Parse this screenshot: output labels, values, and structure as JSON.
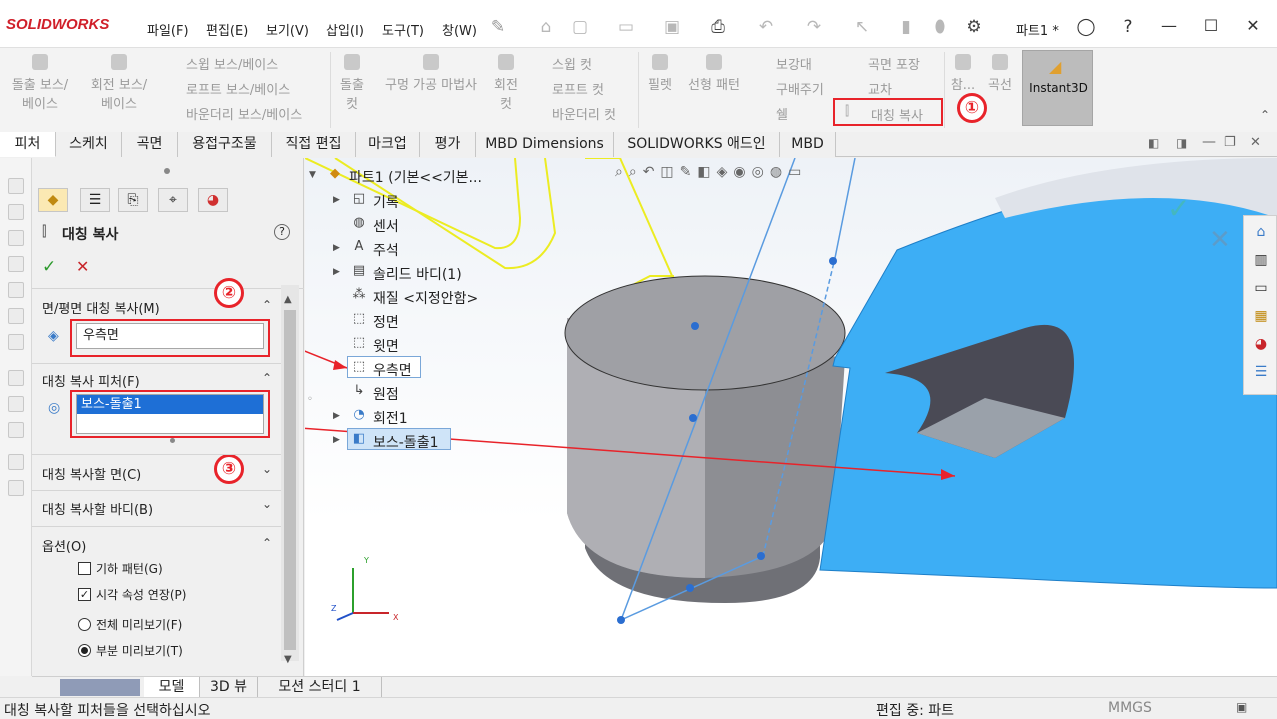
{
  "app": {
    "logo": "SOLIDWORKS",
    "doc_title": "파트1 *"
  },
  "menu": [
    "파일(F)",
    "편집(E)",
    "보기(V)",
    "삽입(I)",
    "도구(T)",
    "창(W)"
  ],
  "quick_access_icons": [
    "pin-icon",
    "home-icon",
    "new-icon",
    "open-icon",
    "save-icon",
    "print-icon",
    "undo-icon",
    "redo-icon",
    "select-icon",
    "traffic-light-icon",
    "options-icon"
  ],
  "title_icons": [
    "user-icon",
    "help-icon"
  ],
  "ribbon": {
    "col1": [
      "돌출 보스/\n베이스",
      "회전 보스/\n베이스"
    ],
    "col1_small": [
      "스윕 보스/베이스",
      "로프트 보스/베이스",
      "바운더리 보스/베이스"
    ],
    "col2": [
      "돌출\n컷",
      "구멍 가공 마법사",
      "회전\n컷"
    ],
    "col2_small": [
      "스윕 컷",
      "로프트 컷",
      "바운더리 컷"
    ],
    "col3": [
      "필렛",
      "선형 패턴"
    ],
    "col3_small": [
      "보강대",
      "구배주기",
      "쉘"
    ],
    "col3_small_b": [
      "곡면 포장",
      "교차",
      "대칭 복사"
    ],
    "col4": [
      "참...",
      "곡선"
    ],
    "instant3d": "Instant3D"
  },
  "tabs": [
    "피처",
    "스케치",
    "곡면",
    "용접구조물",
    "직접 편집",
    "마크업",
    "평가",
    "MBD Dimensions",
    "SOLIDWORKS 애드인",
    "MBD"
  ],
  "property_manager": {
    "title": "대칭 복사",
    "sections": {
      "mirror_face": {
        "title": "면/평면 대칭 복사(M)",
        "value": "우측면"
      },
      "features": {
        "title": "대칭 복사 피처(F)",
        "items": [
          "보스-돌출1"
        ]
      },
      "faces": {
        "title": "대칭 복사할 면(C)"
      },
      "bodies": {
        "title": "대칭 복사할 바디(B)"
      },
      "options": {
        "title": "옵션(O)",
        "items": [
          {
            "label": "기하 패턴(G)",
            "type": "checkbox",
            "checked": false
          },
          {
            "label": "시각 속성 연장(P)",
            "type": "checkbox",
            "checked": true
          },
          {
            "label": "전체 미리보기(F)",
            "type": "radio",
            "checked": false
          },
          {
            "label": "부분 미리보기(T)",
            "type": "radio",
            "checked": true
          }
        ]
      }
    }
  },
  "annotations": [
    "①",
    "②",
    "③"
  ],
  "feature_tree": {
    "root": "파트1  (기본<<기본...",
    "items": [
      {
        "label": "기록",
        "icon": "history-icon",
        "expandable": true
      },
      {
        "label": "센서",
        "icon": "sensor-icon",
        "expandable": false
      },
      {
        "label": "주석",
        "icon": "annotation-icon",
        "expandable": true
      },
      {
        "label": "솔리드 바디(1)",
        "icon": "solid-body-icon",
        "expandable": true
      },
      {
        "label": "재질 <지정안함>",
        "icon": "material-icon",
        "expandable": false
      },
      {
        "label": "정면",
        "icon": "plane-icon",
        "expandable": false
      },
      {
        "label": "윗면",
        "icon": "plane-icon",
        "expandable": false
      },
      {
        "label": "우측면",
        "icon": "plane-icon",
        "expandable": false,
        "selected": true
      },
      {
        "label": "원점",
        "icon": "origin-icon",
        "expandable": false
      },
      {
        "label": "회전1",
        "icon": "revolve-icon",
        "expandable": true
      },
      {
        "label": "보스-돌출1",
        "icon": "extrude-icon",
        "expandable": true,
        "selected": true
      }
    ]
  },
  "bottom_tabs": [
    "모델",
    "3D 뷰",
    "모션 스터디 1"
  ],
  "status": {
    "left": "대칭 복사할 피처들을 선택하십시오",
    "mid": "편집 중: 파트",
    "units": "MMGS"
  },
  "triad": {
    "x": "X",
    "y": "Y",
    "z": "Z"
  },
  "colors": {
    "accent": "#1e6fd6",
    "highlight": "#e8232a",
    "body_blue": "#3daef5"
  }
}
